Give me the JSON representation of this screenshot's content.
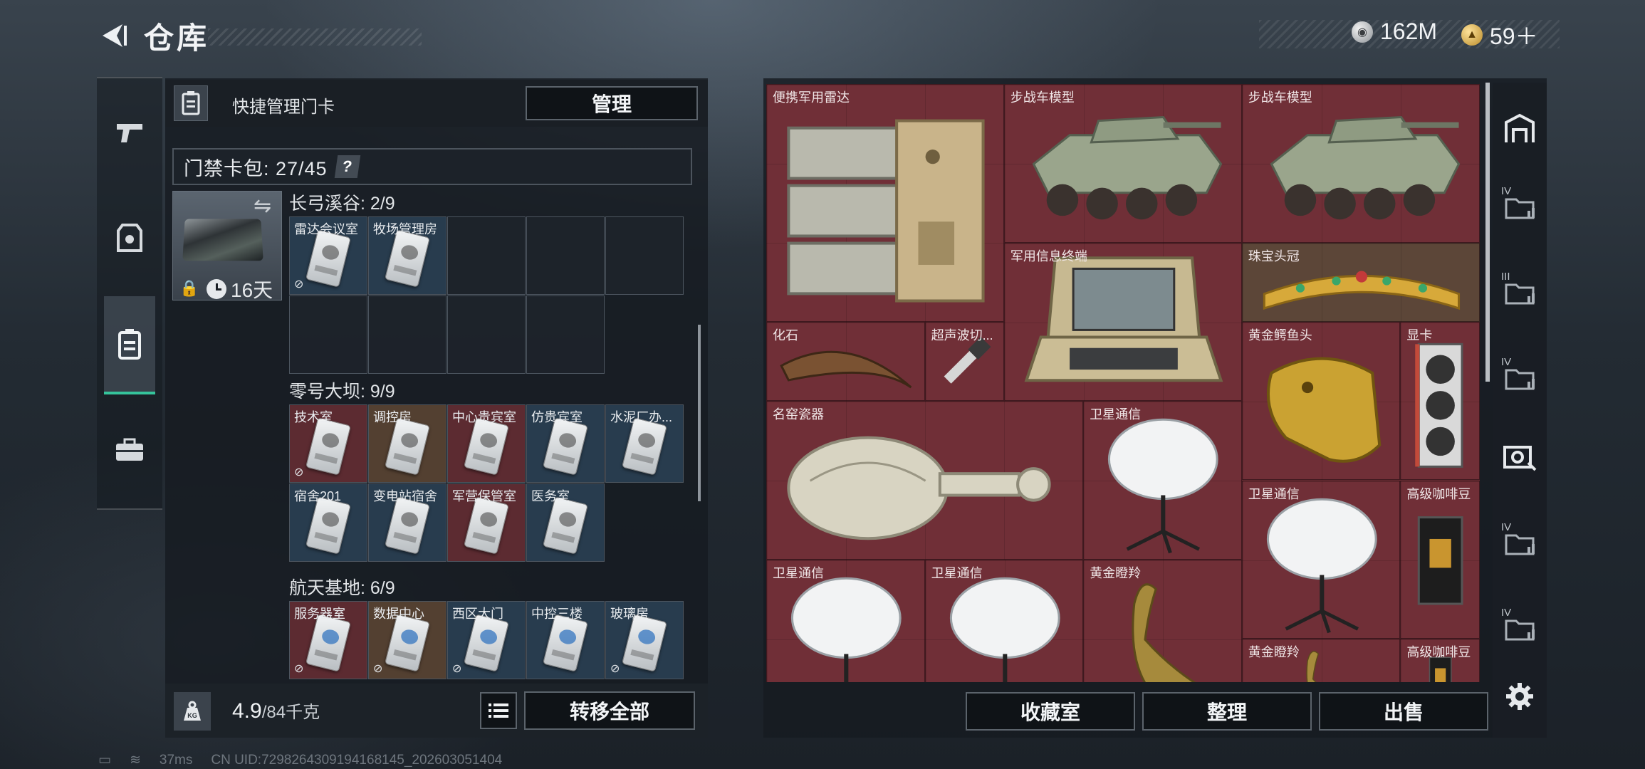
{
  "header": {
    "title": "仓库"
  },
  "currency": {
    "silver": "162M",
    "gold": "59＋"
  },
  "left_rail": [
    {
      "name": "weapon-tab",
      "icon": "pistol-icon"
    },
    {
      "name": "equipment-tab",
      "icon": "armor-icon"
    },
    {
      "name": "keycard-tab",
      "icon": "keycard-icon"
    },
    {
      "name": "case-tab",
      "icon": "briefcase-icon"
    }
  ],
  "keycard_panel": {
    "title": "快捷管理门卡",
    "manage_label": "管理",
    "pack_label": "门禁卡包: 27/45",
    "help_glyph": "?",
    "timer": "16天",
    "groups": [
      {
        "title": "长弓溪谷: 2/9",
        "slots": [
          "雷达会议室",
          "牧场管理房"
        ]
      },
      {
        "title": "零号大坝: 9/9",
        "slots": [
          "技术室",
          "调控房",
          "中心贵宾室",
          "仿贵宾室",
          "水泥厂办...",
          "宿舍201",
          "变电站宿舍",
          "军营保管室",
          "医务室"
        ]
      },
      {
        "title": "航天基地: 6/9",
        "slots": [
          "服务器室",
          "数据中心",
          "西区大门",
          "中控三楼",
          "玻璃房"
        ]
      }
    ]
  },
  "footer_left": {
    "weight": "4.9",
    "weight_unit": "/84千克",
    "transfer_label": "转移全部"
  },
  "inventory": {
    "items": [
      "便携军用雷达",
      "步战车模型",
      "步战车模型",
      "军用信息终端",
      "珠宝头冠",
      "化石",
      "超声波切...",
      "黄金鳄鱼头",
      "显卡",
      "名窑瓷器",
      "卫星通信",
      "卫星通信",
      "高级咖啡豆",
      "卫星通信",
      "卫星通信",
      "黄金瞪羚",
      "黄金瞪羚",
      "高级咖啡豆"
    ]
  },
  "footer_right": {
    "collection_label": "收藏室",
    "sort_label": "整理",
    "sell_label": "出售"
  },
  "right_rail": {
    "badges": [
      "IV",
      "III",
      "IV",
      "IV",
      "IV"
    ]
  },
  "status_bar": {
    "ping": "37ms",
    "uid": "CN UID:7298264309194168145_202603051404"
  }
}
